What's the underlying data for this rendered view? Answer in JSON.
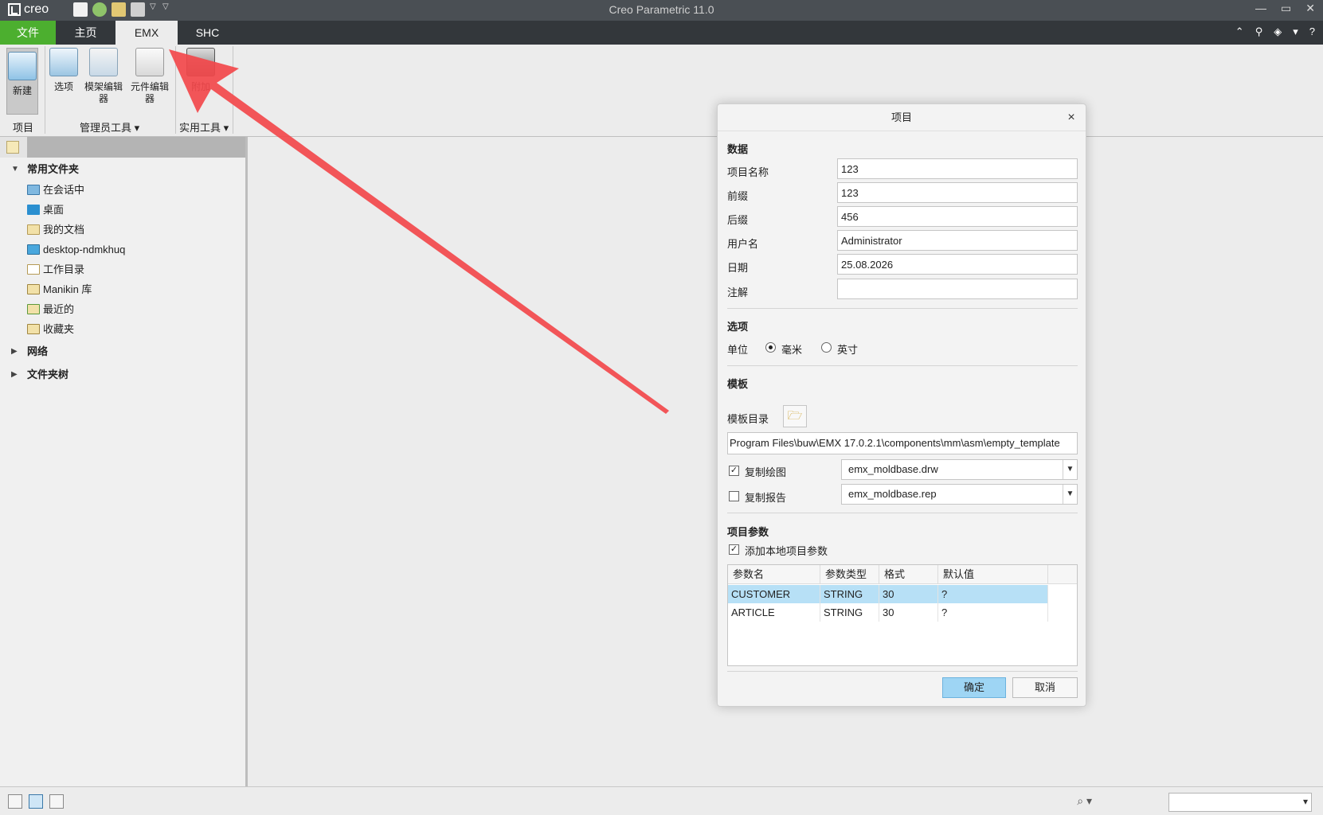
{
  "app": {
    "logo_text": "creo",
    "window_title": "Creo Parametric 11.0",
    "window_controls": [
      "—",
      "▭",
      "✕"
    ]
  },
  "tabs": [
    {
      "label": "文件"
    },
    {
      "label": "主页"
    },
    {
      "label": "EMX"
    },
    {
      "label": "SHC"
    }
  ],
  "ribbon": {
    "new_label": "新建",
    "options_label": "选项",
    "mold_editor_label": "模架编辑器",
    "component_editor_label": "元件编辑器",
    "utility_label": "附加",
    "group_project": "项目",
    "group_admin": "管理员工具",
    "group_util": "实用工具"
  },
  "navigator": {
    "common_folders": "常用文件夹",
    "items": [
      {
        "label": "在会话中",
        "icon": "monitor-icon"
      },
      {
        "label": "桌面",
        "icon": "desktop-icon"
      },
      {
        "label": "我的文档",
        "icon": "documents-icon"
      },
      {
        "label": "desktop-ndmkhuq",
        "icon": "computer-icon"
      },
      {
        "label": "工作目录",
        "icon": "working-directory-icon"
      },
      {
        "label": "Manikin 库",
        "icon": "library-icon"
      },
      {
        "label": "最近的",
        "icon": "recent-icon"
      },
      {
        "label": "收藏夹",
        "icon": "favorites-icon"
      }
    ],
    "network": "网络",
    "folder_tree": "文件夹树"
  },
  "dialog": {
    "title": "项目",
    "section_data": "数据",
    "fields": {
      "project_name_label": "项目名称",
      "project_name": "123",
      "prefix_label": "前缀",
      "prefix": "123",
      "suffix_label": "后缀",
      "suffix": "456",
      "username_label": "用户名",
      "username": "Administrator",
      "date_label": "日期",
      "date": "25.08.2026",
      "comment_label": "注解",
      "comment": ""
    },
    "section_options": "选项",
    "unit_label": "单位",
    "unit_mm": "毫米",
    "unit_inch": "英寸",
    "section_template": "模板",
    "template_dir_label": "模板目录",
    "template_path": "Program Files\\buw\\EMX 17.0.2.1\\components\\mm\\asm\\empty_template",
    "copy_drawing_label": "复制绘图",
    "copy_drawing_value": "emx_moldbase.drw",
    "copy_report_label": "复制报告",
    "copy_report_value": "emx_moldbase.rep",
    "section_params": "项目参数",
    "add_local_params_label": "添加本地项目参数",
    "table": {
      "headers": [
        "参数名",
        "参数类型",
        "格式",
        "默认值"
      ],
      "rows": [
        [
          "CUSTOMER",
          "STRING",
          "30",
          "?"
        ],
        [
          "ARTICLE",
          "STRING",
          "30",
          "?"
        ]
      ]
    },
    "ok_label": "确定",
    "cancel_label": "取消"
  },
  "colors": {
    "file_tab": "#4caf2f",
    "tab_bar": "#33373b",
    "title_bar": "#4a4f54",
    "selection": "#b7e0f6",
    "ok_button": "#9ed5f4",
    "arrow": "#f2484b"
  }
}
